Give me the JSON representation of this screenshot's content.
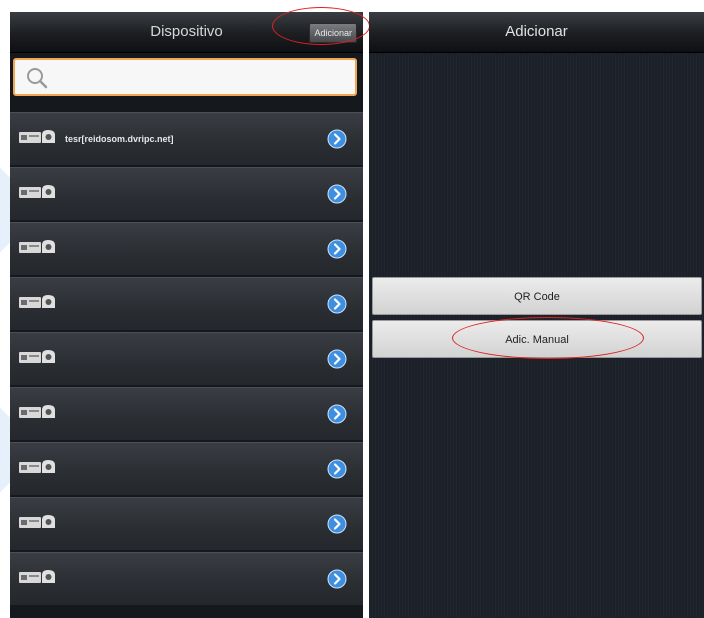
{
  "left_screen": {
    "header": {
      "title": "Dispositivo",
      "add_label": "Adicionar"
    },
    "search": {
      "placeholder": "",
      "icon": "search-icon"
    },
    "devices": [
      {
        "name": "tesr[reidosom.dvripc.net]"
      },
      {
        "name": ""
      },
      {
        "name": ""
      },
      {
        "name": ""
      },
      {
        "name": ""
      },
      {
        "name": ""
      },
      {
        "name": ""
      },
      {
        "name": ""
      },
      {
        "name": ""
      }
    ]
  },
  "right_screen": {
    "header": {
      "title": "Adicionar"
    },
    "options": [
      {
        "label": "QR Code"
      },
      {
        "label": "Adic. Manual"
      }
    ]
  },
  "colors": {
    "accent_highlight": "#e02020",
    "search_border": "#f2a650",
    "arrow_button": "#3f8fe0"
  }
}
